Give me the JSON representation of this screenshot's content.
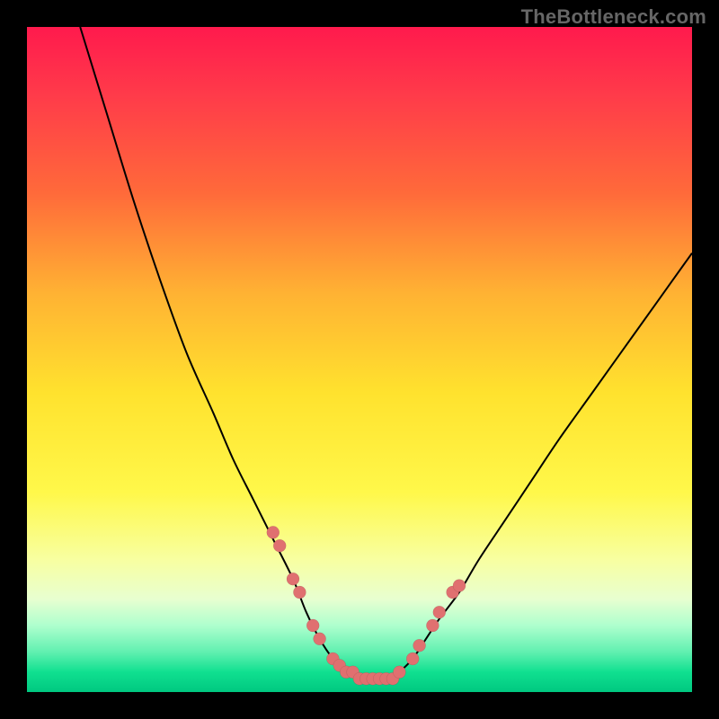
{
  "watermark": {
    "text": "TheBottleneck.com"
  },
  "chart_data": {
    "type": "line",
    "title": "",
    "xlabel": "",
    "ylabel": "",
    "xlim": [
      0,
      100
    ],
    "ylim": [
      0,
      100
    ],
    "series": [
      {
        "name": "left-curve",
        "x": [
          8,
          12,
          16,
          20,
          24,
          28,
          31,
          34,
          37,
          40,
          42,
          44,
          46,
          48
        ],
        "values": [
          100,
          87,
          74,
          62,
          51,
          42,
          35,
          29,
          23,
          17,
          12,
          8,
          5,
          3
        ]
      },
      {
        "name": "right-curve",
        "x": [
          56,
          58,
          60,
          62,
          65,
          68,
          72,
          76,
          80,
          85,
          90,
          95,
          100
        ],
        "values": [
          3,
          5,
          8,
          11,
          15,
          20,
          26,
          32,
          38,
          45,
          52,
          59,
          66
        ]
      },
      {
        "name": "valley-floor",
        "x": [
          48,
          50,
          52,
          54,
          56
        ],
        "values": [
          3,
          2,
          2,
          2,
          3
        ]
      }
    ],
    "markers": {
      "name": "highlighted-points",
      "x": [
        37,
        38,
        40,
        41,
        43,
        44,
        46,
        47,
        48,
        49,
        50,
        51,
        52,
        53,
        54,
        55,
        56,
        58,
        59,
        61,
        62,
        64,
        65
      ],
      "values": [
        24,
        22,
        17,
        15,
        10,
        8,
        5,
        4,
        3,
        3,
        2,
        2,
        2,
        2,
        2,
        2,
        3,
        5,
        7,
        10,
        12,
        15,
        16
      ]
    }
  }
}
